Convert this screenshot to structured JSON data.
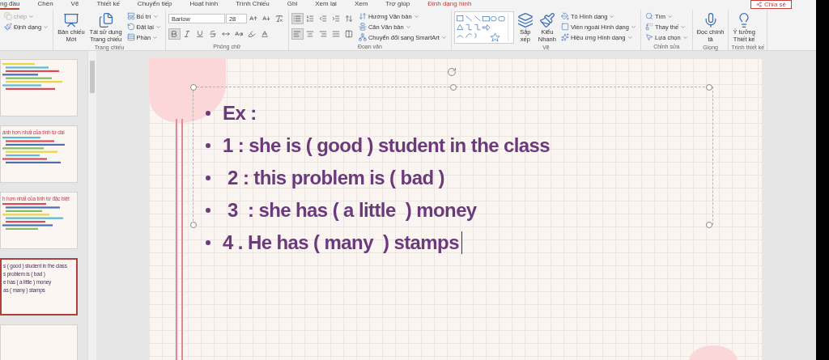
{
  "tabs": [
    {
      "label": "ng đầu",
      "selected": true,
      "kind": "normal"
    },
    {
      "label": "Chèn",
      "selected": false,
      "kind": "normal"
    },
    {
      "label": "Vẽ",
      "selected": false,
      "kind": "normal"
    },
    {
      "label": "Thiết kế",
      "selected": false,
      "kind": "normal"
    },
    {
      "label": "Chuyển tiếp",
      "selected": false,
      "kind": "normal"
    },
    {
      "label": "Hoạt hình",
      "selected": false,
      "kind": "normal"
    },
    {
      "label": "Trình Chiếu",
      "selected": false,
      "kind": "normal"
    },
    {
      "label": "Ghi",
      "selected": false,
      "kind": "normal"
    },
    {
      "label": "Xem lại",
      "selected": false,
      "kind": "normal"
    },
    {
      "label": "Xem",
      "selected": false,
      "kind": "normal"
    },
    {
      "label": "Trợ giúp",
      "selected": false,
      "kind": "normal"
    },
    {
      "label": "Định dạng hình",
      "selected": false,
      "kind": "contextual"
    }
  ],
  "share_button": "Chia sẻ",
  "ribbon": [
    {
      "columns": [
        [
          {
            "kind": "small",
            "label": "chép",
            "disabled": true
          },
          {
            "kind": "small",
            "label": "Định dạng",
            "disabled": false
          }
        ]
      ]
    },
    {
      "label": "Trang chiếu",
      "columns": [
        [
          {
            "kind": "large",
            "lines": [
              "Bản chiếu",
              "Mới"
            ]
          }
        ],
        [
          {
            "kind": "large",
            "lines": [
              "Tái sử dụng",
              "Trang chiếu"
            ]
          }
        ],
        [
          {
            "kind": "small",
            "label": "Bố trí"
          },
          {
            "kind": "small",
            "label": "Đặt lại"
          },
          {
            "kind": "small",
            "label": "Phần"
          }
        ]
      ]
    },
    {
      "label": "Phông chữ",
      "columns": [
        [
          {
            "kind": "toolrow",
            "items": [
              {
                "kind": "field",
                "value": "Barlow"
              },
              {
                "kind": "field",
                "value": "28"
              },
              {
                "kind": "toggle",
                "selected": false
              },
              {
                "kind": "toggle",
                "selected": false
              },
              {
                "kind": "toggle",
                "selected": false
              }
            ]
          },
          {
            "kind": "toolrow",
            "items": [
              {
                "kind": "toggle",
                "selected": true
              },
              {
                "kind": "toggle",
                "selected": false
              },
              {
                "kind": "toggle",
                "selected": false
              },
              {
                "kind": "toggle",
                "selected": false
              },
              {
                "kind": "toggle",
                "selected": false
              },
              {
                "kind": "toggle",
                "selected": false
              },
              {
                "kind": "toggle",
                "selected": false
              },
              {
                "kind": "toggle",
                "selected": false
              }
            ]
          }
        ]
      ]
    },
    {
      "label": "Đoạn văn",
      "columns": [
        [
          {
            "kind": "toolrow",
            "items": [
              {
                "kind": "toggle",
                "selected": true
              },
              {
                "kind": "toggle",
                "selected": false
              },
              {
                "kind": "toggle",
                "selected": false
              },
              {
                "kind": "toggle",
                "selected": false
              },
              {
                "kind": "toggle",
                "selected": false
              }
            ]
          },
          {
            "kind": "toolrow",
            "items": [
              {
                "kind": "toggle",
                "selected": true
              },
              {
                "kind": "toggle",
                "selected": false
              },
              {
                "kind": "toggle",
                "selected": false
              },
              {
                "kind": "toggle",
                "selected": false
              },
              {
                "kind": "toggle",
                "selected": false
              }
            ]
          }
        ],
        [
          {
            "kind": "small",
            "label": "Hướng Văn bản"
          },
          {
            "kind": "small",
            "label": "Căn Văn bản"
          },
          {
            "kind": "small",
            "label": "Chuyển đổi sang SmartArt"
          }
        ]
      ]
    },
    {
      "label": "Vẽ",
      "columns": [
        [
          {
            "kind": "gallery"
          }
        ],
        [
          {
            "kind": "large",
            "lines": [
              "Sắp",
              "xếp"
            ]
          }
        ],
        [
          {
            "kind": "large",
            "lines": [
              "Kiểu",
              "Nhanh"
            ]
          }
        ],
        [
          {
            "kind": "small",
            "label": "Tô Hình dạng"
          },
          {
            "kind": "small",
            "label": "Viền ngoài Hình dạng"
          },
          {
            "kind": "small",
            "label": "Hiệu ứng Hình dạng"
          }
        ]
      ]
    },
    {
      "label": "Chỉnh sửa",
      "columns": [
        [
          {
            "kind": "small",
            "label": "Tìm"
          },
          {
            "kind": "small",
            "label": "Thay thế"
          },
          {
            "kind": "small",
            "label": "Lựa chọn"
          }
        ]
      ]
    },
    {
      "label": "Giọng",
      "columns": [
        [
          {
            "kind": "large",
            "lines": [
              "Đọc chính",
              "tả"
            ]
          }
        ]
      ]
    },
    {
      "label": "Trình thiết kế",
      "columns": [
        [
          {
            "kind": "large",
            "lines": [
              "Ý tưởng",
              "Thiết kế"
            ]
          }
        ]
      ]
    }
  ],
  "thumbnails": [
    {
      "selected": false
    },
    {
      "selected": false,
      "title": "ánh hơn nhất của tính từ dài"
    },
    {
      "selected": false,
      "title": "h hơn nhất của tính từ đặc biệt"
    },
    {
      "selected": true,
      "lines": [
        "s ( good ) student in the class",
        "s problem is ( bad )",
        "e has ( a little ) money",
        "as ( many ) stamps"
      ]
    },
    {
      "selected": false
    }
  ],
  "slide": {
    "bullets": [
      "Ex :",
      "1 : she is ( good ) student in the class",
      " 2 : this problem is ( bad )",
      " 3  : she has ( a little  ) money",
      "4 . He has ( many  ) stamps"
    ]
  }
}
